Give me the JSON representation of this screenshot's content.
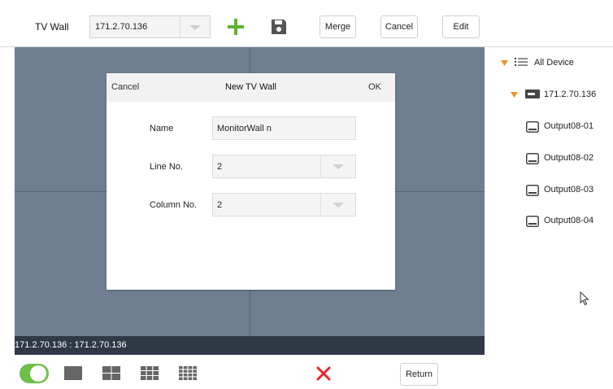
{
  "toolbar": {
    "title": "TV Wall",
    "device_select_value": "171.2.70.136",
    "merge_label": "Merge",
    "cancel_label": "Cancel",
    "edit_label": "Edit",
    "add_icon": "plus-icon",
    "save_icon": "floppy-disk-icon",
    "add_color": "#5cb531"
  },
  "wall": {
    "status_text": "171.2.70.136 : 171.2.70.136",
    "background_color": "#6f7f91",
    "status_bar_color": "#303846"
  },
  "dialog": {
    "cancel_label": "Cancel",
    "title": "New TV Wall",
    "ok_label": "OK",
    "fields": [
      {
        "label": "Name",
        "value": "MonitorWall n"
      },
      {
        "label": "Line No.",
        "value": "2"
      },
      {
        "label": "Column No.",
        "value": "2"
      }
    ]
  },
  "tree": {
    "root_label": "All Device",
    "device_label": "171.2.70.136",
    "caret_color": "#e8952a",
    "outputs": [
      {
        "label": "Output08-01"
      },
      {
        "label": "Output08-02"
      },
      {
        "label": "Output08-03"
      },
      {
        "label": "Output08-04"
      }
    ]
  },
  "bottom": {
    "toggle_on": true,
    "toggle_color": "#6cc04a",
    "delete_color": "#e8262a",
    "return_label": "Return"
  }
}
